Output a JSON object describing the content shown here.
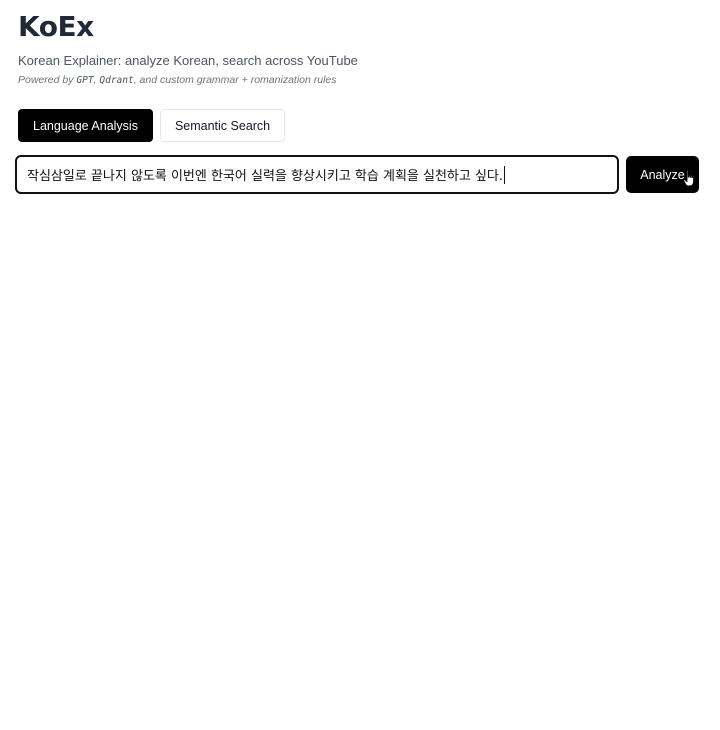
{
  "app": {
    "title": "KoEx",
    "subtitle": "Korean Explainer: analyze Korean, search across YouTube",
    "powered": {
      "prefix": "Powered by ",
      "tech1": "GPT",
      "sep1": ", ",
      "tech2": "Qdrant",
      "suffix": ", and custom grammar + romanization rules"
    }
  },
  "tabs": [
    {
      "label": "Language Analysis",
      "active": true
    },
    {
      "label": "Semantic Search",
      "active": false
    }
  ],
  "search": {
    "value": "작심삼일로 끝나지 않도록 이번엔 한국어 실력을 향상시키고 학습 계획을 실천하고 싶다.",
    "button_label": "Analyze"
  },
  "icons": {
    "cursor": "hand-pointer-icon"
  },
  "colors": {
    "primary": "#000000",
    "text": "#1f2937",
    "muted": "#6b7280",
    "border": "#e5e7eb"
  }
}
